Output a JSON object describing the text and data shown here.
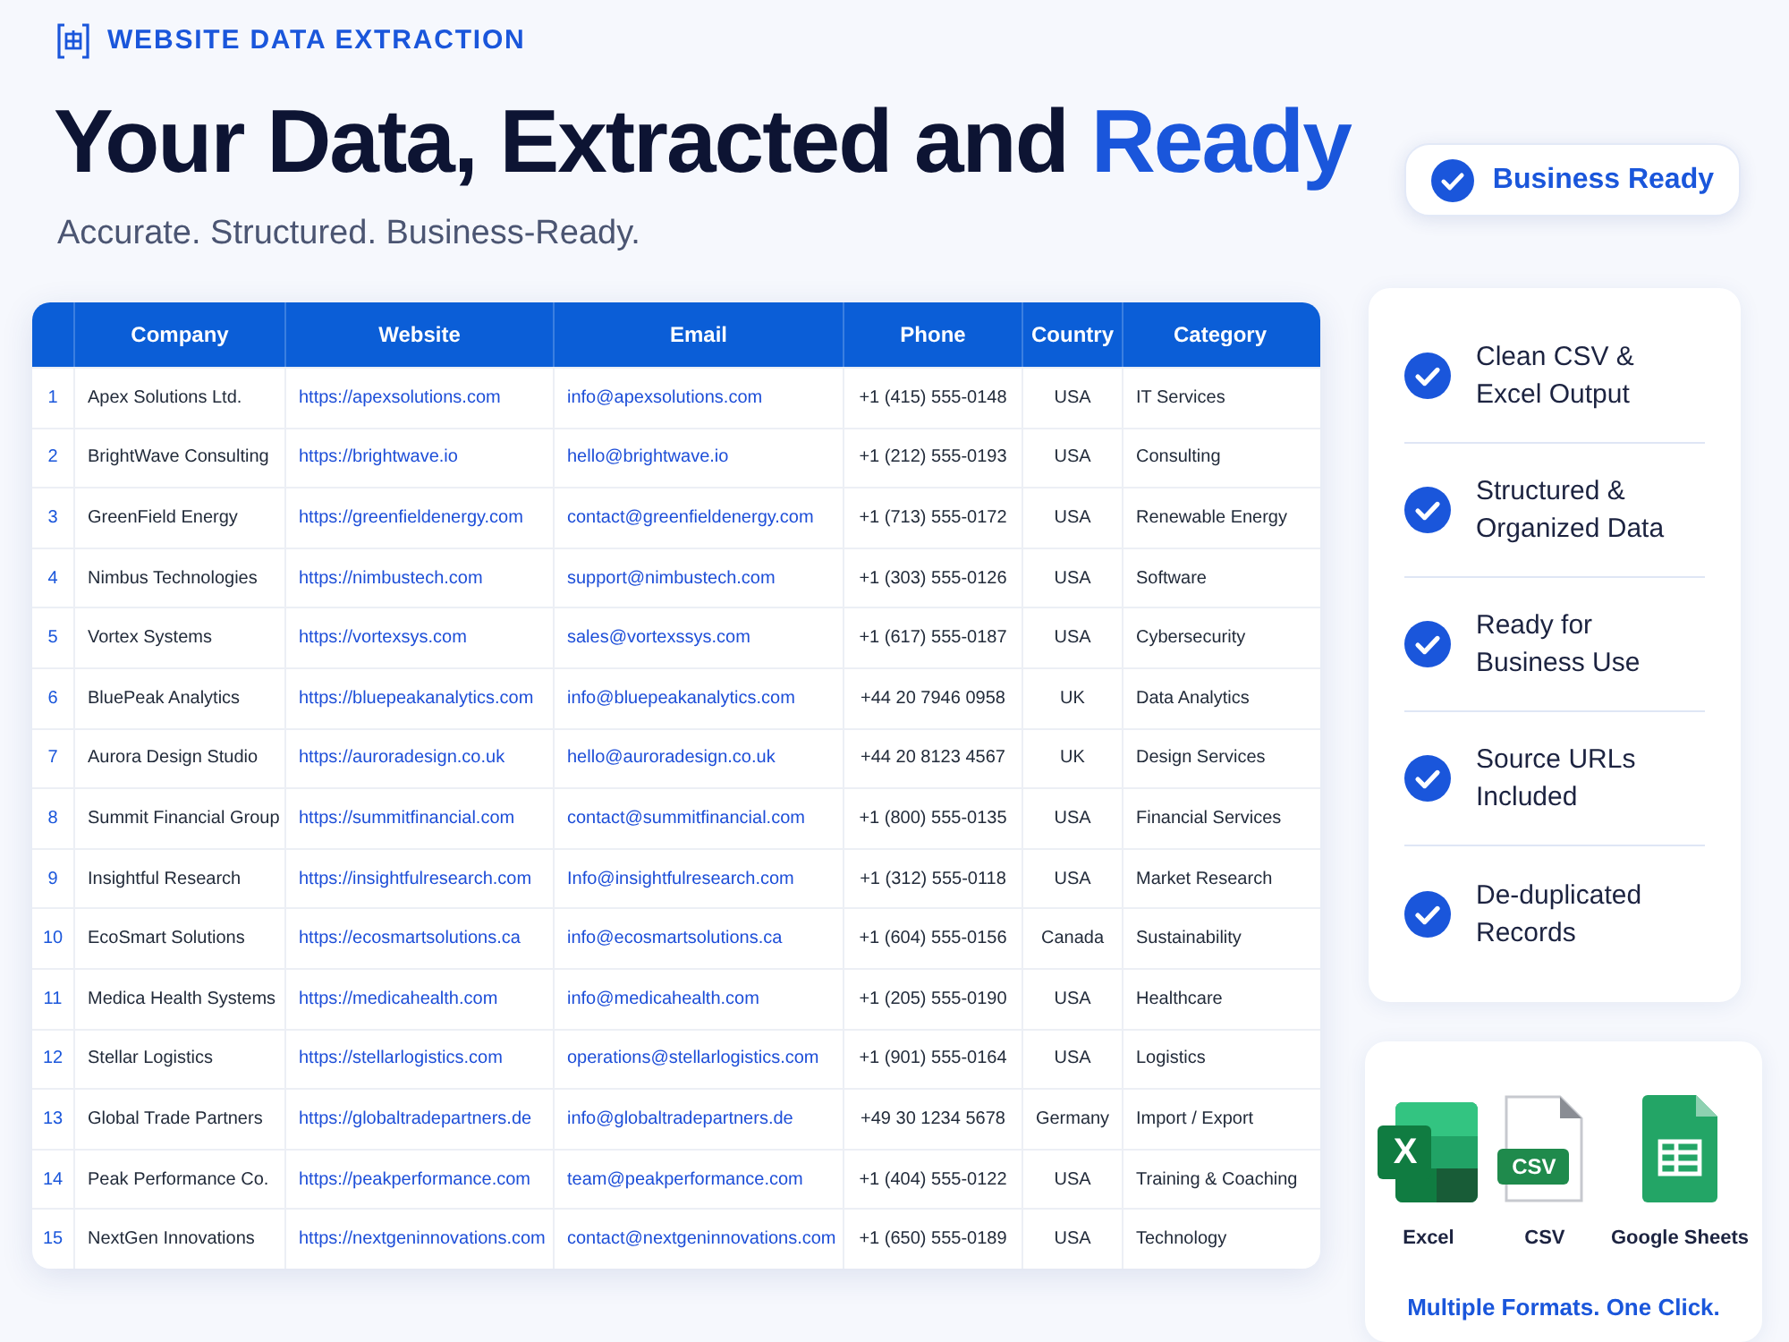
{
  "eyebrow": "WEBSITE DATA EXTRACTION",
  "headline": {
    "text": "Your Data, Extracted and",
    "highlight": "Ready"
  },
  "subtitle": "Accurate. Structured. Business-Ready.",
  "badge": "Business Ready",
  "table": {
    "columns": [
      "",
      "Company",
      "Website",
      "Email",
      "Phone",
      "Country",
      "Category"
    ],
    "rows": [
      [
        "1",
        "Apex Solutions Ltd.",
        "https://apexsolutions.com",
        "info@apexsolutions.com",
        "+1 (415) 555-0148",
        "USA",
        "IT Services"
      ],
      [
        "2",
        "BrightWave Consulting",
        "https://brightwave.io",
        "hello@brightwave.io",
        "+1 (212) 555-0193",
        "USA",
        "Consulting"
      ],
      [
        "3",
        "GreenField Energy",
        "https://greenfieldenergy.com",
        "contact@greenfieldenergy.com",
        "+1 (713) 555-0172",
        "USA",
        "Renewable Energy"
      ],
      [
        "4",
        "Nimbus Technologies",
        "https://nimbustech.com",
        "support@nimbustech.com",
        "+1 (303) 555-0126",
        "USA",
        "Software"
      ],
      [
        "5",
        "Vortex Systems",
        "https://vortexsys.com",
        "sales@vortexssys.com",
        "+1 (617) 555-0187",
        "USA",
        "Cybersecurity"
      ],
      [
        "6",
        "BluePeak Analytics",
        "https://bluepeakanalytics.com",
        "info@bluepeakanalytics.com",
        "+44 20 7946 0958",
        "UK",
        "Data Analytics"
      ],
      [
        "7",
        "Aurora Design Studio",
        "https://auroradesign.co.uk",
        "hello@auroradesign.co.uk",
        "+44 20 8123 4567",
        "UK",
        "Design Services"
      ],
      [
        "8",
        "Summit Financial Group",
        "https://summitfinancial.com",
        "contact@summitfinancial.com",
        "+1 (800) 555-0135",
        "USA",
        "Financial Services"
      ],
      [
        "9",
        "Insightful Research",
        "https://insightfulresearch.com",
        "Info@insightfulresearch.com",
        "+1 (312) 555-0118",
        "USA",
        "Market Research"
      ],
      [
        "10",
        "EcoSmart Solutions",
        "https://ecosmartsolutions.ca",
        "info@ecosmartsolutions.ca",
        "+1 (604) 555-0156",
        "Canada",
        "Sustainability"
      ],
      [
        "11",
        "Medica Health Systems",
        "https://medicahealth.com",
        "info@medicahealth.com",
        "+1 (205) 555-0190",
        "USA",
        "Healthcare"
      ],
      [
        "12",
        "Stellar Logistics",
        "https://stellarlogistics.com",
        "operations@stellarlogistics.com",
        "+1 (901) 555-0164",
        "USA",
        "Logistics"
      ],
      [
        "13",
        "Global Trade Partners",
        "https://globaltradepartners.de",
        "info@globaltradepartners.de",
        "+49 30 1234 5678",
        "Germany",
        "Import / Export"
      ],
      [
        "14",
        "Peak Performance Co.",
        "https://peakperformance.com",
        "team@peakperformance.com",
        "+1 (404) 555-0122",
        "USA",
        "Training & Coaching"
      ],
      [
        "15",
        "NextGen Innovations",
        "https://nextgeninnovations.com",
        "contact@nextgeninnovations.com",
        "+1 (650) 555-0189",
        "USA",
        "Technology"
      ]
    ]
  },
  "features": [
    "Clean CSV & Excel Output",
    "Structured & Organized Data",
    "Ready for Business Use",
    "Source URLs Included",
    "De-duplicated Records"
  ],
  "formats": [
    {
      "kind": "excel",
      "icon_text": "X",
      "label": "Excel"
    },
    {
      "kind": "csv",
      "icon_text": "CSV",
      "label": "CSV"
    },
    {
      "kind": "sheets",
      "label": "Google Sheets"
    }
  ],
  "formats_caption": "Multiple Formats. One Click."
}
